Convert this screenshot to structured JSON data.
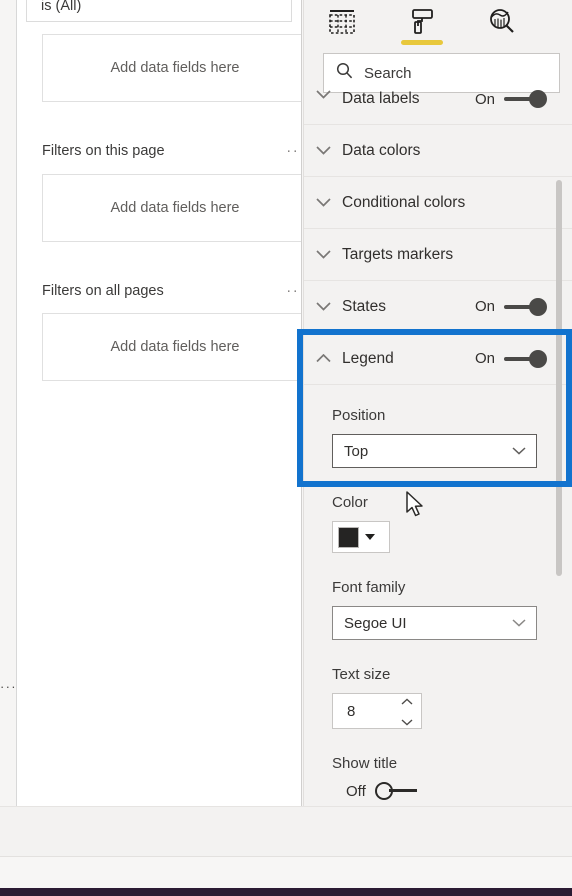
{
  "filters_pane": {
    "existing_filter_value": "is (All)",
    "dropzone_label": "Add data fields here",
    "sections": [
      {
        "title": "Filters on this page",
        "menu": "···",
        "dropzone": "Add data fields here"
      },
      {
        "title": "Filters on all pages",
        "menu": "···",
        "dropzone": "Add data fields here"
      }
    ],
    "edge_menu": "···"
  },
  "format_pane": {
    "tabs": [
      {
        "name": "fields-icon",
        "selected": false
      },
      {
        "name": "format-paint-roller-icon",
        "selected": true
      },
      {
        "name": "analytics-magnifier-icon",
        "selected": false
      }
    ],
    "search": {
      "placeholder": "Search",
      "value": "",
      "icon": "search-icon"
    },
    "sections": [
      {
        "label": "Data labels",
        "toggle_state": "On",
        "toggle_on": true,
        "expanded": false,
        "partial": true
      },
      {
        "label": "Data colors",
        "toggle_state": "",
        "toggle_on": null,
        "expanded": false
      },
      {
        "label": "Conditional colors",
        "toggle_state": "",
        "toggle_on": null,
        "expanded": false
      },
      {
        "label": "Targets markers",
        "toggle_state": "",
        "toggle_on": null,
        "expanded": false
      },
      {
        "label": "States",
        "toggle_state": "On",
        "toggle_on": true,
        "expanded": false
      }
    ],
    "legend": {
      "label": "Legend",
      "toggle_state": "On",
      "toggle_on": true,
      "expanded": true,
      "position": {
        "label": "Position",
        "value": "Top"
      },
      "color": {
        "label": "Color",
        "value": "#252423"
      },
      "font_family": {
        "label": "Font family",
        "value": "Segoe UI"
      },
      "text_size": {
        "label": "Text size",
        "value": "8"
      },
      "show_title": {
        "label": "Show title",
        "state": "Off",
        "on": false
      }
    },
    "highlight_color": "#1273ce",
    "accent_color": "#e8c83c"
  }
}
